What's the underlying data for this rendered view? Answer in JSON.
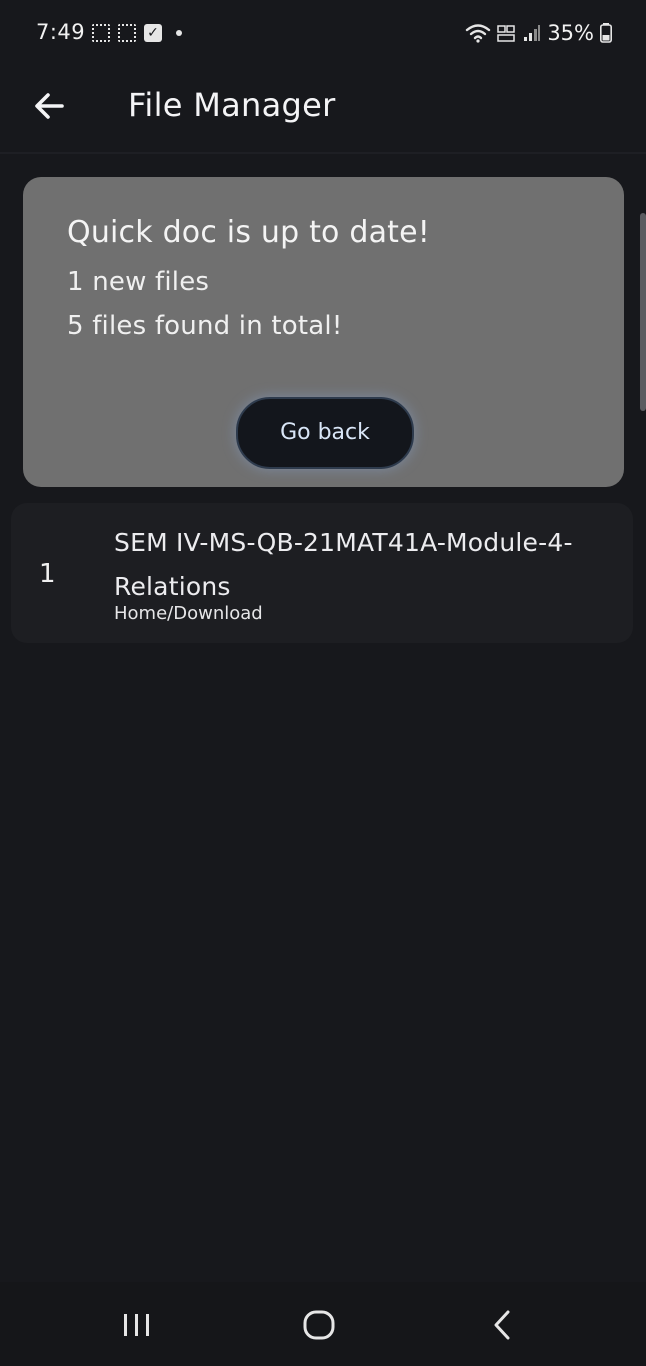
{
  "status_bar": {
    "time": "7:49",
    "battery_percent": "35%",
    "icons": [
      "screenshot-icon",
      "screenshot-icon",
      "checkbox-icon",
      "notification-dot-icon",
      "wifi-icon",
      "volte-icon",
      "signal-icon",
      "battery-icon"
    ]
  },
  "app_bar": {
    "title": "File Manager",
    "back_icon": "arrow-left-icon"
  },
  "summary": {
    "heading": "Quick doc is up to date!",
    "new_files": "1 new files",
    "total_files": "5 files found in total!",
    "go_back_label": "Go back"
  },
  "files": [
    {
      "index": "1",
      "name": "SEM IV-MS-QB-21MAT41A-Module-4-Relations",
      "path": "Home/Download"
    }
  ],
  "nav_bar": {
    "buttons": [
      "recents-icon",
      "home-icon",
      "back-icon"
    ]
  },
  "colors": {
    "background": "#17181c",
    "card": "#707070",
    "file_item": "#1d1e22",
    "button_bg": "#13161c",
    "button_glow": "#96beff"
  }
}
